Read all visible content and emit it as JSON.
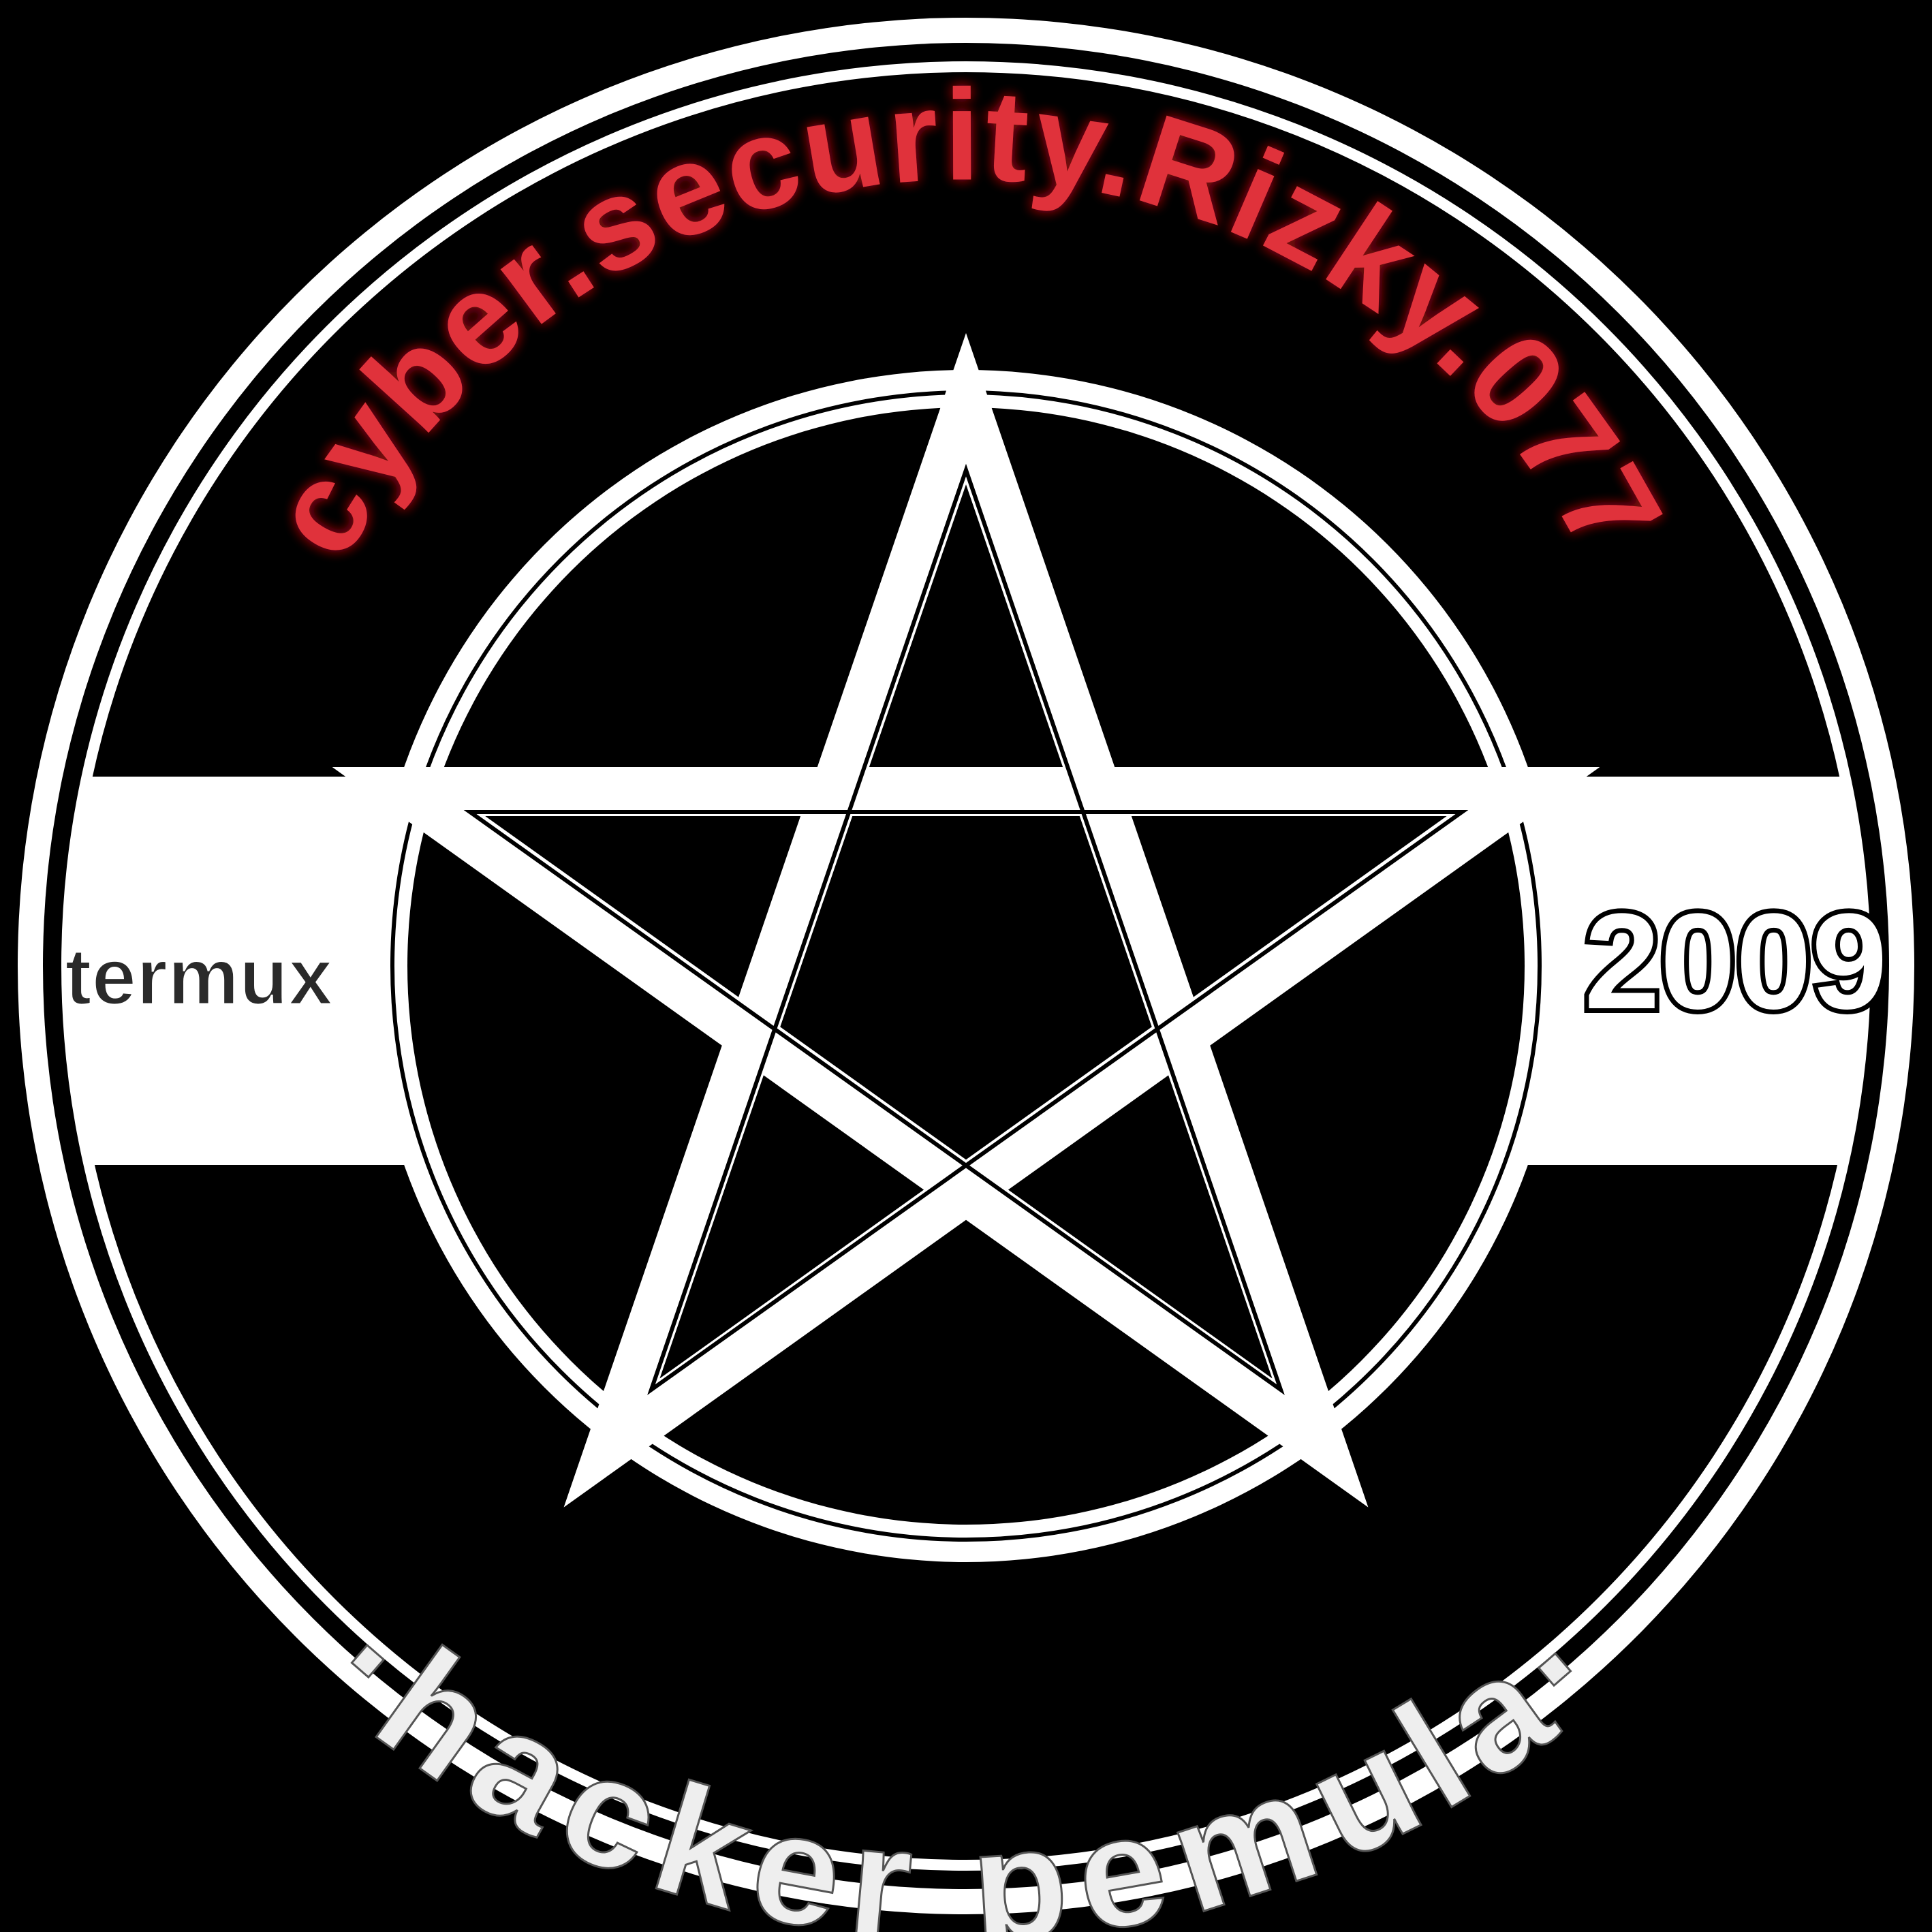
{
  "emblem": {
    "top_text": "cyber.security.Rizky.077",
    "bottom_text": "·hacker pemula·",
    "left_label": "termux",
    "right_label": "2009",
    "center_icon": "pentagram-icon"
  },
  "colors": {
    "background": "#000000",
    "ring": "#ffffff",
    "top_text": "#e0333b",
    "top_text_glow": "#7a0c12",
    "bottom_text": "#eeeeee"
  }
}
